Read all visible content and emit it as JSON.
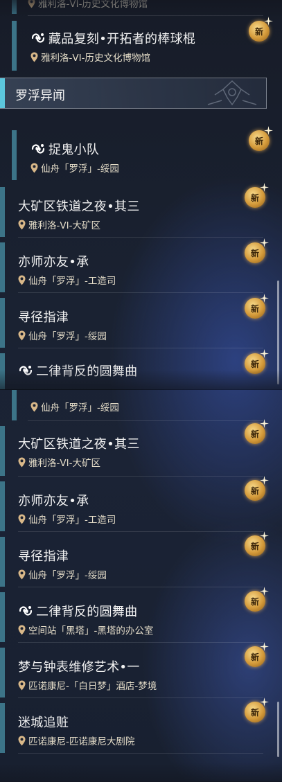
{
  "new_badge": "新",
  "top": {
    "partial_top_loc": "雅利洛-VI-历史文化博物馆",
    "item1": {
      "title": "藏品复刻•开拓者的棒球棍",
      "location": "雅利洛-VI-历史文化博物馆"
    },
    "category": "罗浮异闻",
    "item2": {
      "title": "捉鬼小队",
      "location": "仙舟「罗浮」-绥园"
    },
    "item3": {
      "title": "大矿区铁道之夜•其三",
      "location": "雅利洛-VI-大矿区"
    },
    "item4": {
      "title": "亦师亦友•承",
      "location": "仙舟「罗浮」-工造司"
    },
    "item5": {
      "title": "寻径指津",
      "location": "仙舟「罗浮」-绥园"
    },
    "item6": {
      "title": "二律背反的圆舞曲"
    }
  },
  "bottom": {
    "partial_loc": "仙舟「罗浮」-绥园",
    "items": [
      {
        "title": "大矿区铁道之夜•其三",
        "location": "雅利洛-VI-大矿区"
      },
      {
        "title": "亦师亦友•承",
        "location": "仙舟「罗浮」-工造司"
      },
      {
        "title": "寻径指津",
        "location": "仙舟「罗浮」-绥园"
      },
      {
        "title": "二律背反的圆舞曲",
        "location": "空间站「黑塔」-黑塔的办公室"
      },
      {
        "title": "梦与钟表维修艺术•一",
        "location": "匹诺康尼-「白日梦」酒店-梦境"
      },
      {
        "title": "迷城追赃",
        "location": "匹诺康尼-匹诺康尼大剧院"
      }
    ]
  }
}
